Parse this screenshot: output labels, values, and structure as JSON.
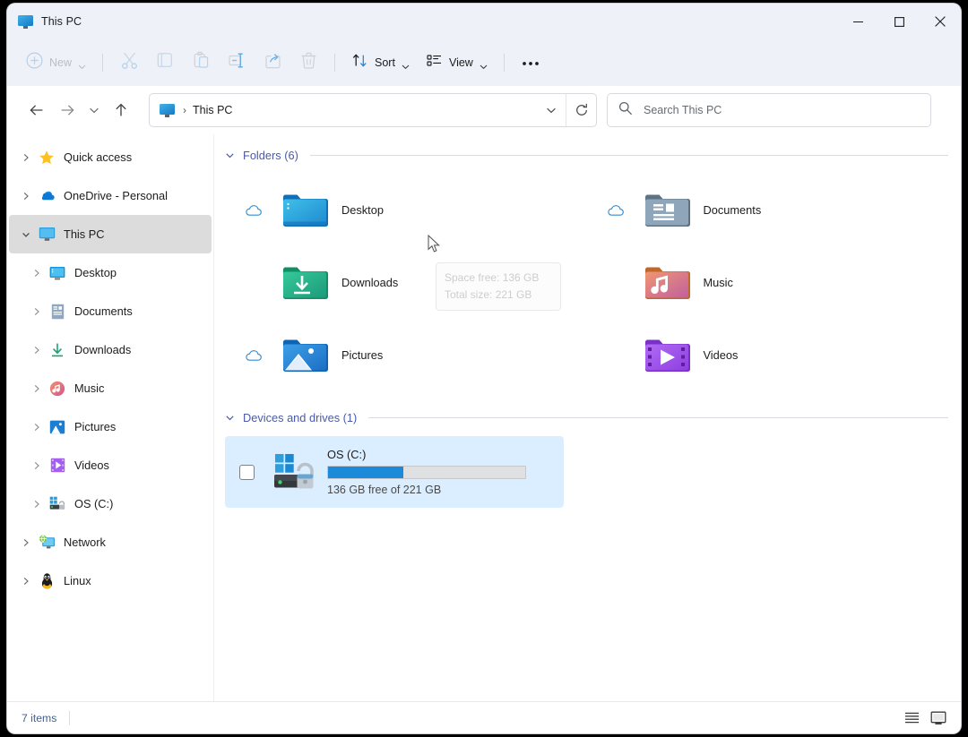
{
  "window": {
    "title": "This PC",
    "title_icon": "this-pc-monitor-icon",
    "controls": {
      "minimize": "minimize-icon",
      "maximize": "maximize-icon",
      "close": "close-icon"
    }
  },
  "toolbar": {
    "new_label": "New",
    "new_icon": "plus-circle-icon",
    "items": [
      {
        "name": "cut-button",
        "icon": "scissors-icon",
        "enabled": false
      },
      {
        "name": "copy-button",
        "icon": "copy-icon",
        "enabled": false
      },
      {
        "name": "paste-button",
        "icon": "clipboard-icon",
        "enabled": false
      },
      {
        "name": "rename-button",
        "icon": "rename-icon",
        "enabled": false
      },
      {
        "name": "share-button",
        "icon": "share-icon",
        "enabled": false
      },
      {
        "name": "delete-button",
        "icon": "trash-icon",
        "enabled": false
      }
    ],
    "sort_label": "Sort",
    "sort_icon": "sort-arrows-icon",
    "view_label": "View",
    "view_icon": "view-list-icon",
    "more_label": "•••",
    "more_icon": "ellipsis-icon"
  },
  "navigation": {
    "back_icon": "arrow-left-icon",
    "forward_icon": "arrow-right-icon",
    "recent_icon": "chevron-down-icon",
    "up_icon": "arrow-up-icon",
    "address": {
      "icon": "this-pc-monitor-icon",
      "separator": "›",
      "crumb": "This PC",
      "dropdown_icon": "chevron-down-icon",
      "refresh_icon": "refresh-icon"
    },
    "search": {
      "icon": "search-icon",
      "placeholder": "Search This PC"
    }
  },
  "sidebar": {
    "items": [
      {
        "label": "Quick access",
        "icon": "star-icon",
        "level": 1,
        "expanded": false,
        "selected": false
      },
      {
        "label": "OneDrive - Personal",
        "icon": "onedrive-icon",
        "level": 1,
        "expanded": false,
        "selected": false
      },
      {
        "label": "This PC",
        "icon": "this-pc-icon",
        "level": 1,
        "expanded": true,
        "selected": true
      },
      {
        "label": "Desktop",
        "icon": "desktop-icon",
        "level": 2,
        "expanded": false,
        "selected": false
      },
      {
        "label": "Documents",
        "icon": "documents-icon",
        "level": 2,
        "expanded": false,
        "selected": false
      },
      {
        "label": "Downloads",
        "icon": "downloads-icon",
        "level": 2,
        "expanded": false,
        "selected": false
      },
      {
        "label": "Music",
        "icon": "music-icon",
        "level": 2,
        "expanded": false,
        "selected": false
      },
      {
        "label": "Pictures",
        "icon": "pictures-icon",
        "level": 2,
        "expanded": false,
        "selected": false
      },
      {
        "label": "Videos",
        "icon": "videos-icon",
        "level": 2,
        "expanded": false,
        "selected": false
      },
      {
        "label": "OS (C:)",
        "icon": "drive-icon",
        "level": 2,
        "expanded": false,
        "selected": false
      },
      {
        "label": "Network",
        "icon": "network-icon",
        "level": 1,
        "expanded": false,
        "selected": false
      },
      {
        "label": "Linux",
        "icon": "linux-icon",
        "level": 1,
        "expanded": false,
        "selected": false
      }
    ]
  },
  "content": {
    "folders_group": {
      "title": "Folders (6)",
      "count": 6,
      "expanded": true,
      "items": [
        {
          "label": "Desktop",
          "icon": "folder-desktop-icon",
          "cloud": true
        },
        {
          "label": "Documents",
          "icon": "folder-documents-icon",
          "cloud": true
        },
        {
          "label": "Downloads",
          "icon": "folder-downloads-icon",
          "cloud": false
        },
        {
          "label": "Music",
          "icon": "folder-music-icon",
          "cloud": false
        },
        {
          "label": "Pictures",
          "icon": "folder-pictures-icon",
          "cloud": true
        },
        {
          "label": "Videos",
          "icon": "folder-videos-icon",
          "cloud": false
        }
      ]
    },
    "drives_group": {
      "title": "Devices and drives (1)",
      "count": 1,
      "expanded": true,
      "drive": {
        "name": "OS (C:)",
        "icon": "windows-drive-icon",
        "free_text": "136 GB free of 221 GB",
        "free_gb": 136,
        "total_gb": 221,
        "used_percent": 38,
        "selected": true,
        "checkbox_checked": false
      }
    },
    "tooltip": {
      "line1": "Space free: 136 GB",
      "line2": "Total size: 221 GB"
    }
  },
  "statusbar": {
    "item_count_text": "7 items",
    "details_view_icon": "details-view-icon",
    "large_icons_view_icon": "large-icons-view-icon"
  },
  "colors": {
    "chrome": "#eef1f8",
    "accent_blue": "#1b8ad8",
    "group_header": "#4a5aa8",
    "selection": "#dbeeff",
    "sidebar_selection": "#dcdcdc",
    "status_text": "#43618e"
  }
}
